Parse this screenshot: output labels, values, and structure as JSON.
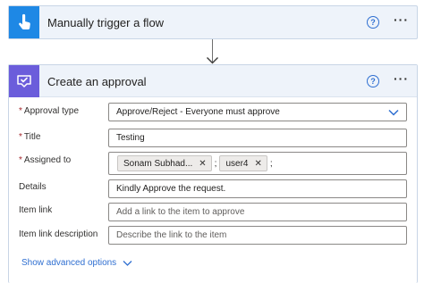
{
  "trigger": {
    "title": "Manually trigger a flow",
    "icon": "touch-hand-icon",
    "help_glyph": "?",
    "more_glyph": "···"
  },
  "approval": {
    "title": "Create an approval",
    "icon": "approval-icon",
    "help_glyph": "?",
    "more_glyph": "···",
    "fields": {
      "approval_type": {
        "label": "Approval type",
        "required": true,
        "value": "Approve/Reject - Everyone must approve"
      },
      "title": {
        "label": "Title",
        "required": true,
        "value": "Testing"
      },
      "assigned_to": {
        "label": "Assigned to",
        "required": true,
        "tokens": [
          "Sonam Subhad...",
          "user4"
        ],
        "separator": ";"
      },
      "details": {
        "label": "Details",
        "value": "Kindly Approve the request."
      },
      "item_link": {
        "label": "Item link",
        "placeholder": "Add a link to the item to approve"
      },
      "item_link_description": {
        "label": "Item link description",
        "placeholder": "Describe the link to the item"
      }
    },
    "show_advanced_label": "Show advanced options"
  },
  "colors": {
    "trigger_tile": "#1e88e5",
    "approval_tile": "#6b5ddb",
    "header_bg": "#eef3fa",
    "link_blue": "#2f6fd1",
    "required_red": "#a4262c"
  }
}
